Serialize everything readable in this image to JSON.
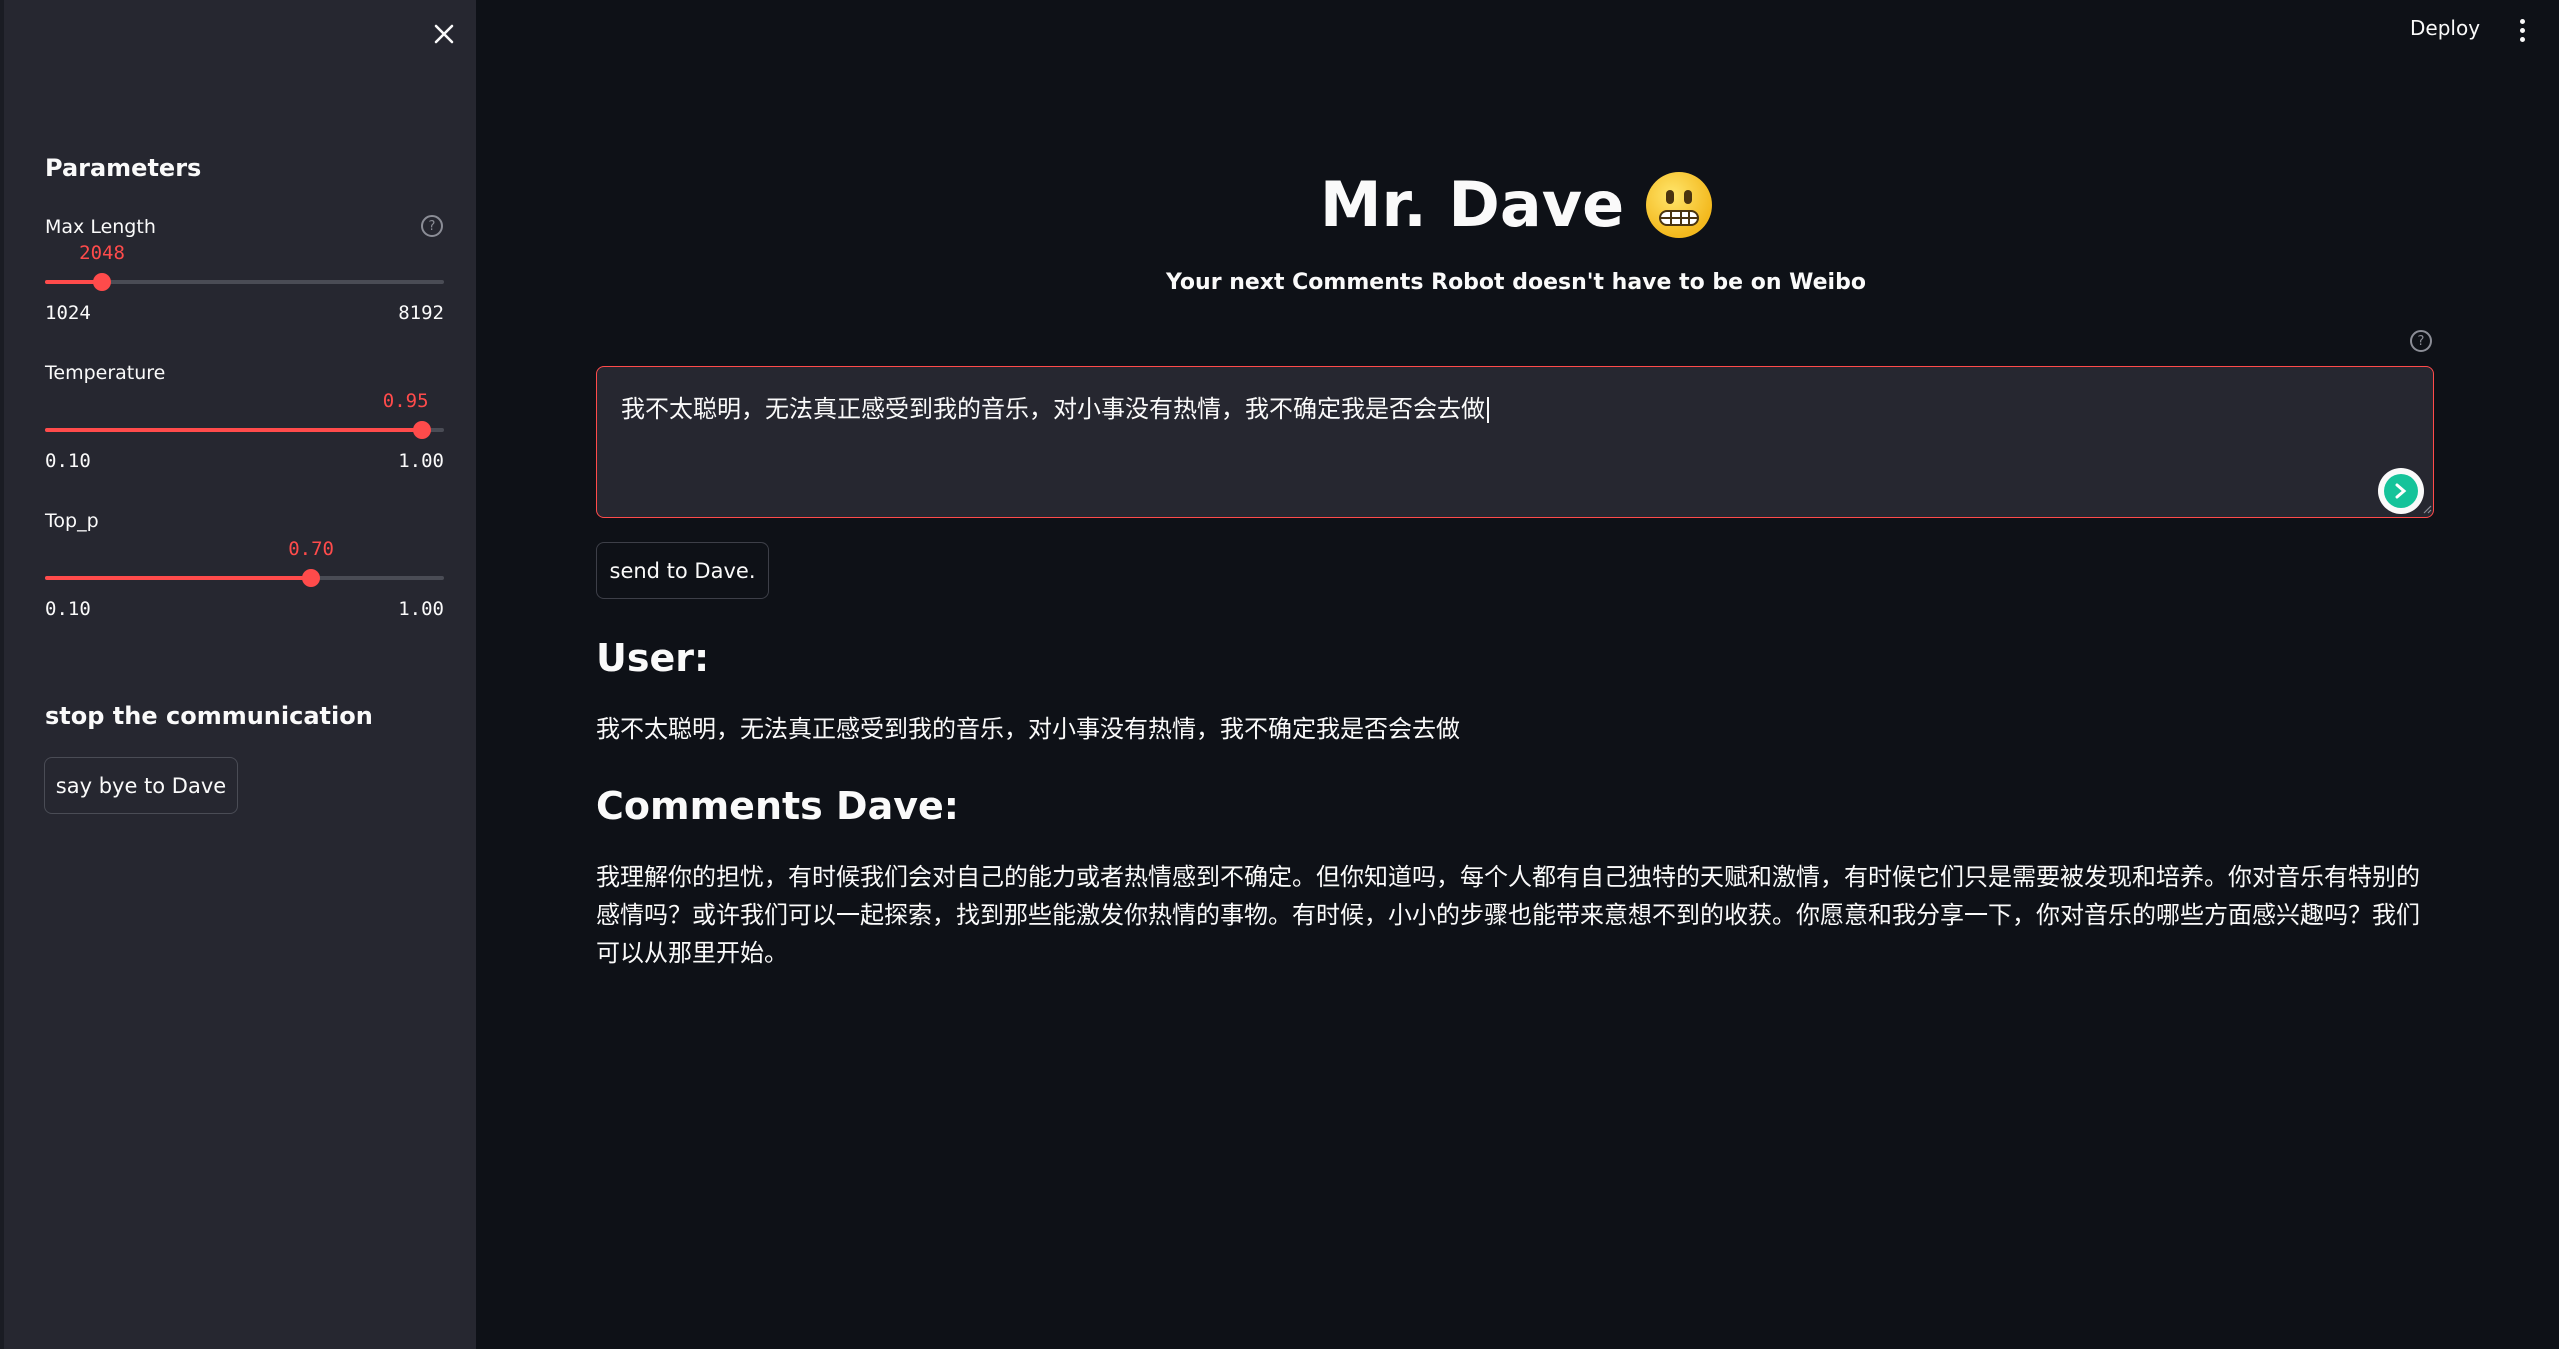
{
  "sidebar": {
    "parameters_heading": "Parameters",
    "max_length": {
      "label": "Max Length",
      "value": "2048",
      "min": "1024",
      "max": "8192",
      "fraction": 0.143
    },
    "temperature": {
      "label": "Temperature",
      "value": "0.95",
      "min": "0.10",
      "max": "1.00",
      "fraction": 0.944
    },
    "top_p": {
      "label": "Top_p",
      "value": "0.70",
      "min": "0.10",
      "max": "1.00",
      "fraction": 0.667
    },
    "stop_heading": "stop the communication",
    "bye_button": "say bye to Dave"
  },
  "header": {
    "deploy_label": "Deploy"
  },
  "main": {
    "title": "Mr. Dave",
    "subtitle": "Your next Comments Robot doesn't have to be on Weibo",
    "input_value": "我不太聪明，无法真正感受到我的音乐，对小事没有热情，我不确定我是否会去做",
    "send_button": "send to Dave.",
    "user_heading": "User:",
    "user_message": "我不太聪明，无法真正感受到我的音乐，对小事没有热情，我不确定我是否会去做",
    "dave_heading": "Comments Dave:",
    "dave_message": "我理解你的担忧，有时候我们会对自己的能力或者热情感到不确定。但你知道吗，每个人都有自己独特的天赋和激情，有时候它们只是需要被发现和培养。你对音乐有特别的感情吗？或许我们可以一起探索，找到那些能激发你热情的事物。有时候，小小的步骤也能带来意想不到的收获。你愿意和我分享一下，你对音乐的哪些方面感兴趣吗？我们可以从那里开始。"
  },
  "colors": {
    "accent": "#ff4b4b",
    "sidebar_bg": "#262730",
    "main_bg": "#0e1117"
  },
  "icons": [
    "close-icon",
    "help-icon",
    "kebab-menu-icon",
    "grimacing-emoji-icon",
    "grammarly-icon"
  ]
}
